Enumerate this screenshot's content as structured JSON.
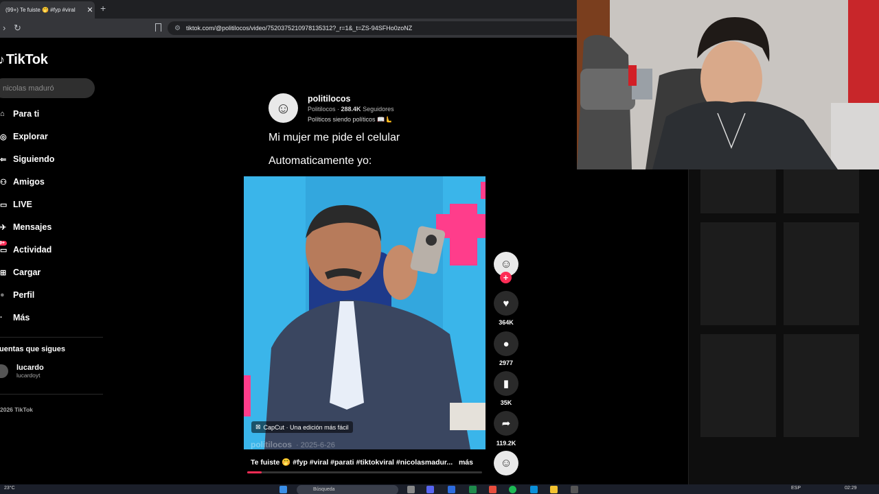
{
  "browser": {
    "tab_title": "(99+) Te fuiste 🤭 #fyp #viral",
    "tab_close": "✕",
    "new_tab": "+",
    "url": "tiktok.com/@politilocos/video/7520375210978135312?_r=1&_t=ZS-94SFHo0zoNZ"
  },
  "sidebar": {
    "logo": "TikTok",
    "search_value": "nicolas maduró",
    "items": [
      {
        "label": "Para ti",
        "icon": "⌂"
      },
      {
        "label": "Explorar",
        "icon": "◎"
      },
      {
        "label": "Siguiendo",
        "icon": "⇐"
      },
      {
        "label": "Amigos",
        "icon": "⚇"
      },
      {
        "label": "LIVE",
        "icon": "▭"
      },
      {
        "label": "Mensajes",
        "icon": "✈"
      },
      {
        "label": "Actividad",
        "icon": "▭",
        "badge": "9+"
      },
      {
        "label": "Cargar",
        "icon": "⊞"
      },
      {
        "label": "Perfil",
        "icon": "●"
      },
      {
        "label": "Más",
        "icon": "·"
      }
    ],
    "following_title": "uentas que sigues",
    "following": [
      {
        "name": "lucardo",
        "handle": "lucardoyt"
      }
    ],
    "copyright": "2026 TikTok"
  },
  "post": {
    "author": "politilocos",
    "author_display": "Politilocos",
    "followers": "288.4K",
    "followers_label": "Seguidores",
    "bio": "Políticos siendo políticos 📖🫷",
    "caption_line1": "Mi mujer me pide el celular",
    "caption_line2": "Automaticamente yo:",
    "watermark": "CapCut · Una edición más fácil",
    "video_author": "politilocos",
    "video_date": "· 2025-6-26",
    "description": "Te fuiste 🤭 #fyp #viral #parati #tiktokviral #nicolasmadur...",
    "more": "más",
    "progress": 0.06
  },
  "actions": {
    "follow_plus": "+",
    "likes": "364K",
    "comments": "2977",
    "saves": "35K",
    "shares": "119.2K"
  },
  "taskbar": {
    "temp": "23°C",
    "search": "Búsqueda",
    "lang": "ESP",
    "time": "02:29"
  },
  "colors": {
    "accent": "#fe2c55",
    "video_bg": "#3ab5ea",
    "pink": "#ff3d8b"
  }
}
